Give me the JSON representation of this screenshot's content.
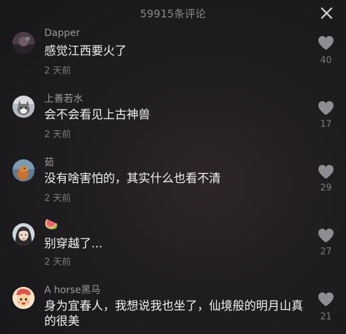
{
  "header": {
    "title": "59915条评论",
    "close_icon": "close-icon"
  },
  "comments": [
    {
      "username": "Dapper",
      "text": "感觉江西要火了",
      "time": "2 天前",
      "likes": "40",
      "avatar_icon": "avatar-dark-icon"
    },
    {
      "username": "上善若水",
      "text": "会不会看见上古神兽",
      "time": "2 天前",
      "likes": "17",
      "avatar_icon": "avatar-cat-icon"
    },
    {
      "username": "茹",
      "text": "没有啥害怕的，其实什么也看不清",
      "time": "2 天前",
      "likes": "29",
      "avatar_icon": "avatar-bird-icon"
    },
    {
      "username": "🍉",
      "text": "别穿越了...",
      "time": "2 天前",
      "likes": "27",
      "avatar_icon": "avatar-girl-icon"
    },
    {
      "username": "A horse黑马",
      "text": "身为宜春人，我想说我也坐了，仙境般的明月山真的很美",
      "time": "",
      "likes": "21",
      "avatar_icon": "avatar-cartoon-icon"
    }
  ],
  "colors": {
    "background": "#1f1d1f",
    "username": "#9a9a9e",
    "text": "#f2f2f2",
    "muted": "#7b7b80",
    "heart": "#8e8e92"
  }
}
